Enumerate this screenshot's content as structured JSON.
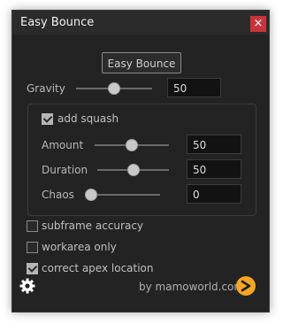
{
  "window": {
    "title": "Easy Bounce",
    "close_glyph": "×"
  },
  "bounce_button": {
    "label": "Easy Bounce"
  },
  "gravity": {
    "label": "Gravity",
    "value": "50",
    "level": 0.5
  },
  "squash": {
    "checkbox_label": "add squash",
    "checked": true,
    "amount": {
      "label": "Amount",
      "value": "50",
      "level": 0.5
    },
    "duration": {
      "label": "Duration",
      "value": "50",
      "level": 0.5
    },
    "chaos": {
      "label": "Chaos",
      "value": "0",
      "level": 0.0
    }
  },
  "options": [
    {
      "label": "subframe accuracy",
      "checked": false
    },
    {
      "label": "workarea only",
      "checked": false
    },
    {
      "label": "correct apex location",
      "checked": true
    }
  ],
  "footer": {
    "credit": "by mamoworld.com",
    "settings_icon": "gear-icon",
    "logo_icon": "mamoworld-logo-icon",
    "logo_color": "#f5a623"
  },
  "colors": {
    "close": "#c8343b",
    "background": "#232323"
  }
}
